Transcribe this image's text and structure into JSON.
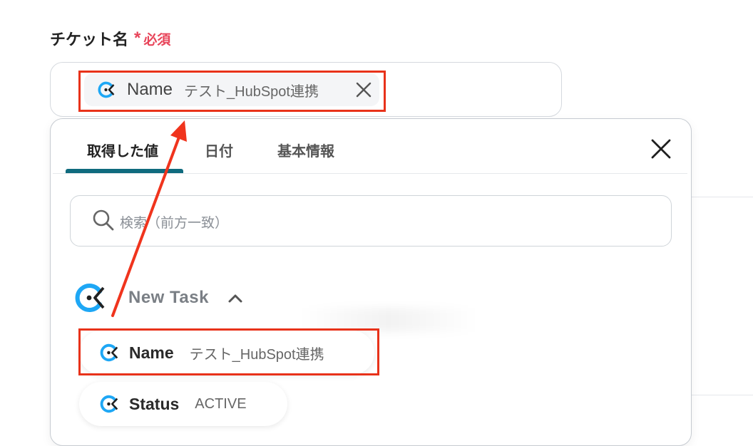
{
  "field": {
    "label": "チケット名",
    "required_mark": "*",
    "required_text": "必須"
  },
  "selected_token": {
    "name": "Name",
    "value": "テスト_HubSpot連携",
    "icon": "clickup-logo-icon",
    "remove_icon": "close-icon"
  },
  "tabs": [
    {
      "label": "取得した値",
      "active": true
    },
    {
      "label": "日付",
      "active": false
    },
    {
      "label": "基本情報",
      "active": false
    }
  ],
  "search": {
    "placeholder": "検索（前方一致）",
    "icon": "search-icon"
  },
  "group": {
    "title": "New Task",
    "icon": "clickup-logo-icon",
    "expanded": true
  },
  "options": [
    {
      "name": "Name",
      "value": "テスト_HubSpot連携"
    },
    {
      "name": "Status",
      "value": "ACTIVE"
    }
  ],
  "colors": {
    "required": "#e8455a",
    "highlight": "#e8321a",
    "tab_active_underline": "#0f6b7e",
    "clickup_logo": "#1ea7f5"
  }
}
